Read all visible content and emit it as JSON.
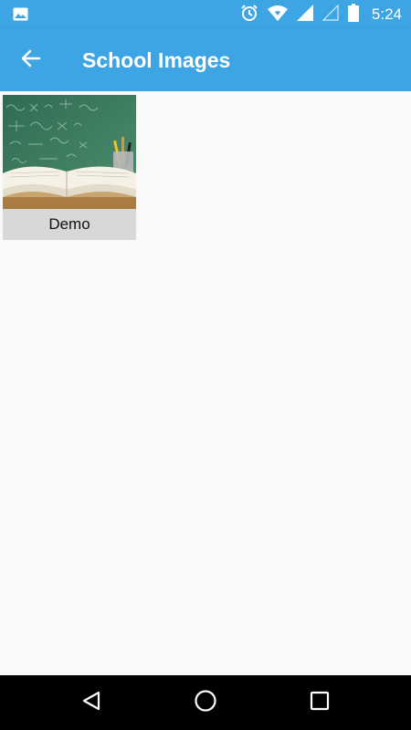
{
  "status_bar": {
    "time": "5:24",
    "icons": [
      "image-notification-icon",
      "alarm-icon",
      "wifi-icon",
      "signal-icon",
      "signal-empty-icon",
      "battery-icon"
    ]
  },
  "app_bar": {
    "title": "School Images",
    "back_icon": "arrow-back-icon"
  },
  "grid": {
    "items": [
      {
        "caption": "Demo",
        "image": "classroom-book-chalkboard"
      }
    ]
  },
  "nav_bar": {
    "buttons": [
      "back-triangle-icon",
      "home-circle-icon",
      "recents-square-icon"
    ]
  },
  "colors": {
    "primary": "#3ea5e4",
    "background": "#fafafa",
    "caption_bg": "#d9d7d7",
    "nav_bar": "#000000"
  }
}
